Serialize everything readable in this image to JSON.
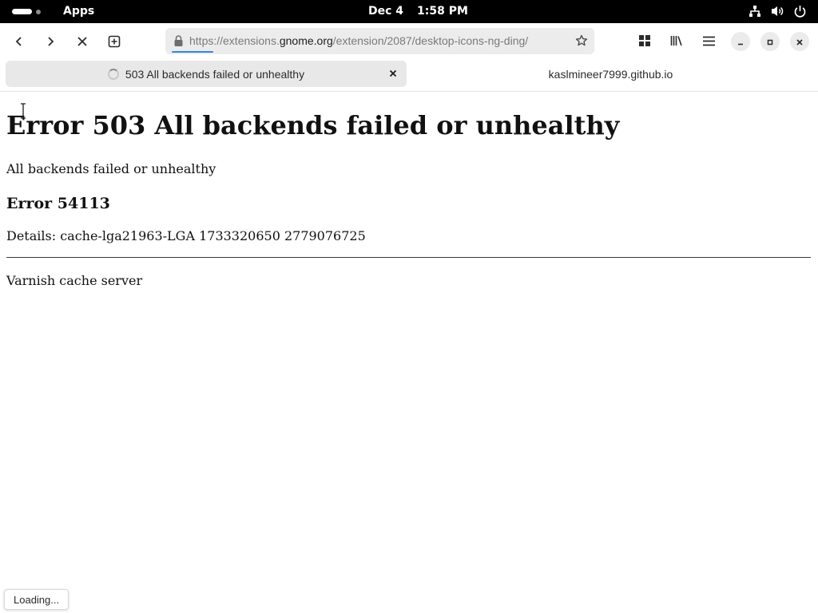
{
  "topbar": {
    "apps_label": "Apps",
    "date": "Dec 4",
    "time": "1:58 PM",
    "tray_icons": [
      "network-icon",
      "volume-icon",
      "power-icon"
    ]
  },
  "browser": {
    "nav": {
      "back_icon": "back-icon",
      "forward_icon": "forward-icon",
      "stop_icon": "stop-icon",
      "new_tab_icon": "new-tab-icon"
    },
    "url": {
      "prefix": "https://extensions.",
      "domain": "gnome.org",
      "path": "/extension/2087/desktop-icons-ng-ding/"
    },
    "tools": [
      "grid-icon",
      "library-icon",
      "menu-icon"
    ],
    "window_controls": [
      "minimize-icon",
      "maximize-icon",
      "close-icon"
    ],
    "tabs": [
      {
        "label": "503 All backends failed or unhealthy",
        "active": true,
        "loading": true
      },
      {
        "label": "kaslmineer7999.github.io",
        "active": false
      }
    ],
    "accent": "#3584e4"
  },
  "page": {
    "title": "Error 503 All backends failed or unhealthy",
    "subtitle": "All backends failed or unhealthy",
    "error_heading": "Error 54113",
    "details": "Details: cache-lga21963-LGA 1733320650 2779076725",
    "footer": "Varnish cache server"
  },
  "status": {
    "text": "Loading..."
  }
}
